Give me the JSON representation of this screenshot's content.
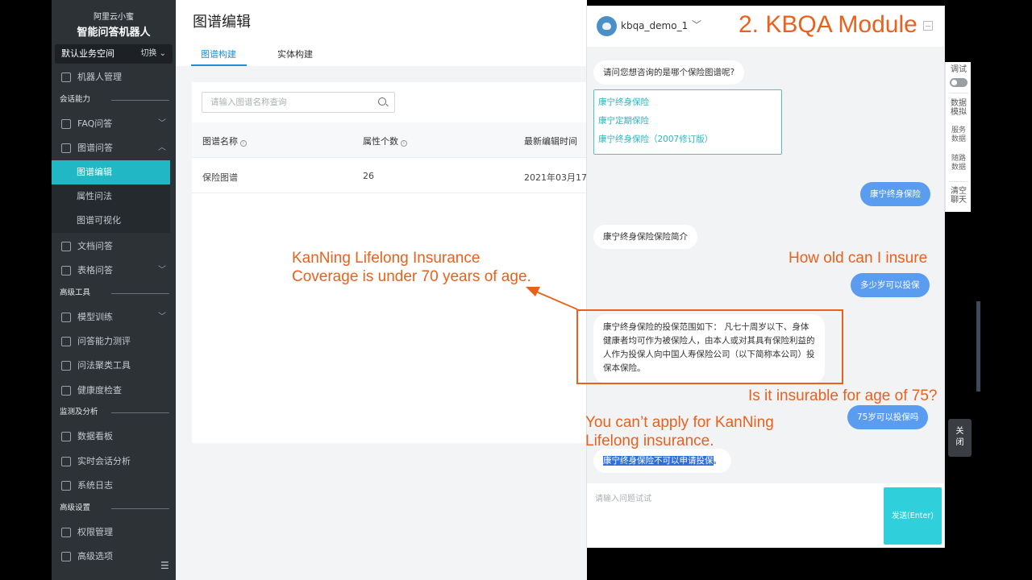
{
  "sidebar": {
    "logo_top": "阿里云小蜜",
    "logo_bottom": "智能问答机器人",
    "workspace": "默认业务空间",
    "switch": "切换",
    "robot_mgmt": "机器人管理",
    "sec_dialog": "会话能力",
    "faq": "FAQ问答",
    "graph_qa": "图谱问答",
    "graph_edit": "图谱编辑",
    "attr_qa": "属性问法",
    "graph_vis": "图谱可视化",
    "doc_qa": "文档问答",
    "table_qa": "表格问答",
    "sec_advtools": "高级工具",
    "model_train": "模型训练",
    "qa_eval": "问答能力测评",
    "cluster": "问法聚类工具",
    "health": "健康度检查",
    "sec_monitor": "监测及分析",
    "dashboard": "数据看板",
    "realtime": "实时会话分析",
    "syslog": "系统日志",
    "sec_advset": "高级设置",
    "perm": "权限管理",
    "adv_opts": "高级选项"
  },
  "main": {
    "title": "图谱编辑",
    "tabs": [
      "图谱构建",
      "实体构建"
    ],
    "search_placeholder": "请输入图谱名称查询",
    "columns": [
      "图谱名称",
      "属性个数",
      "最新编辑时间"
    ],
    "rows": [
      [
        "保险图谱",
        "26",
        "2021年03月17"
      ]
    ]
  },
  "chat": {
    "bot_name": "kbqa_demo_1",
    "msg1": "请问您想咨询的是哪个保险图谱呢?",
    "options": [
      "康宁终身保险",
      "康宁定期保险",
      "康宁终身保险（2007修订版）"
    ],
    "user1": "康宁终身保险",
    "bot2": "康宁终身保险保险简介",
    "user2": "多少岁可以投保",
    "bot3": "康宁终身保险的投保范围如下： 凡七十周岁以下、身体健康者均可作为被保险人，由本人或对其具有保险利益的人作为投保人向中国人寿保险公司（以下简称本公司）投保本保险。",
    "user3": "75岁可以投保吗",
    "bot4_hl": "康宁终身保险不可以申请投保",
    "bot4_tail": "。",
    "input_placeholder": "请输入问题试试",
    "send": "发送(Enter)"
  },
  "tools": {
    "debug": "调试",
    "data_mock": [
      "数据",
      "模拟"
    ],
    "service_data": [
      "服务",
      "数据"
    ],
    "route_data": [
      "随路",
      "数据"
    ],
    "clear_chat": [
      "清空",
      "聊天"
    ],
    "close": [
      "关",
      "闭"
    ]
  },
  "annotations": {
    "module_title": "2. KBQA Module",
    "coverage": [
      "KanNing Lifelong Insurance",
      "Coverage is under 70 years of age."
    ],
    "how_old": "How old can I insure",
    "is_75": "Is it insurable for age of 75?",
    "cant_apply": [
      "You can’t apply for KanNing",
      "Lifelong insurance."
    ],
    "accent_color": "#e8611d"
  }
}
